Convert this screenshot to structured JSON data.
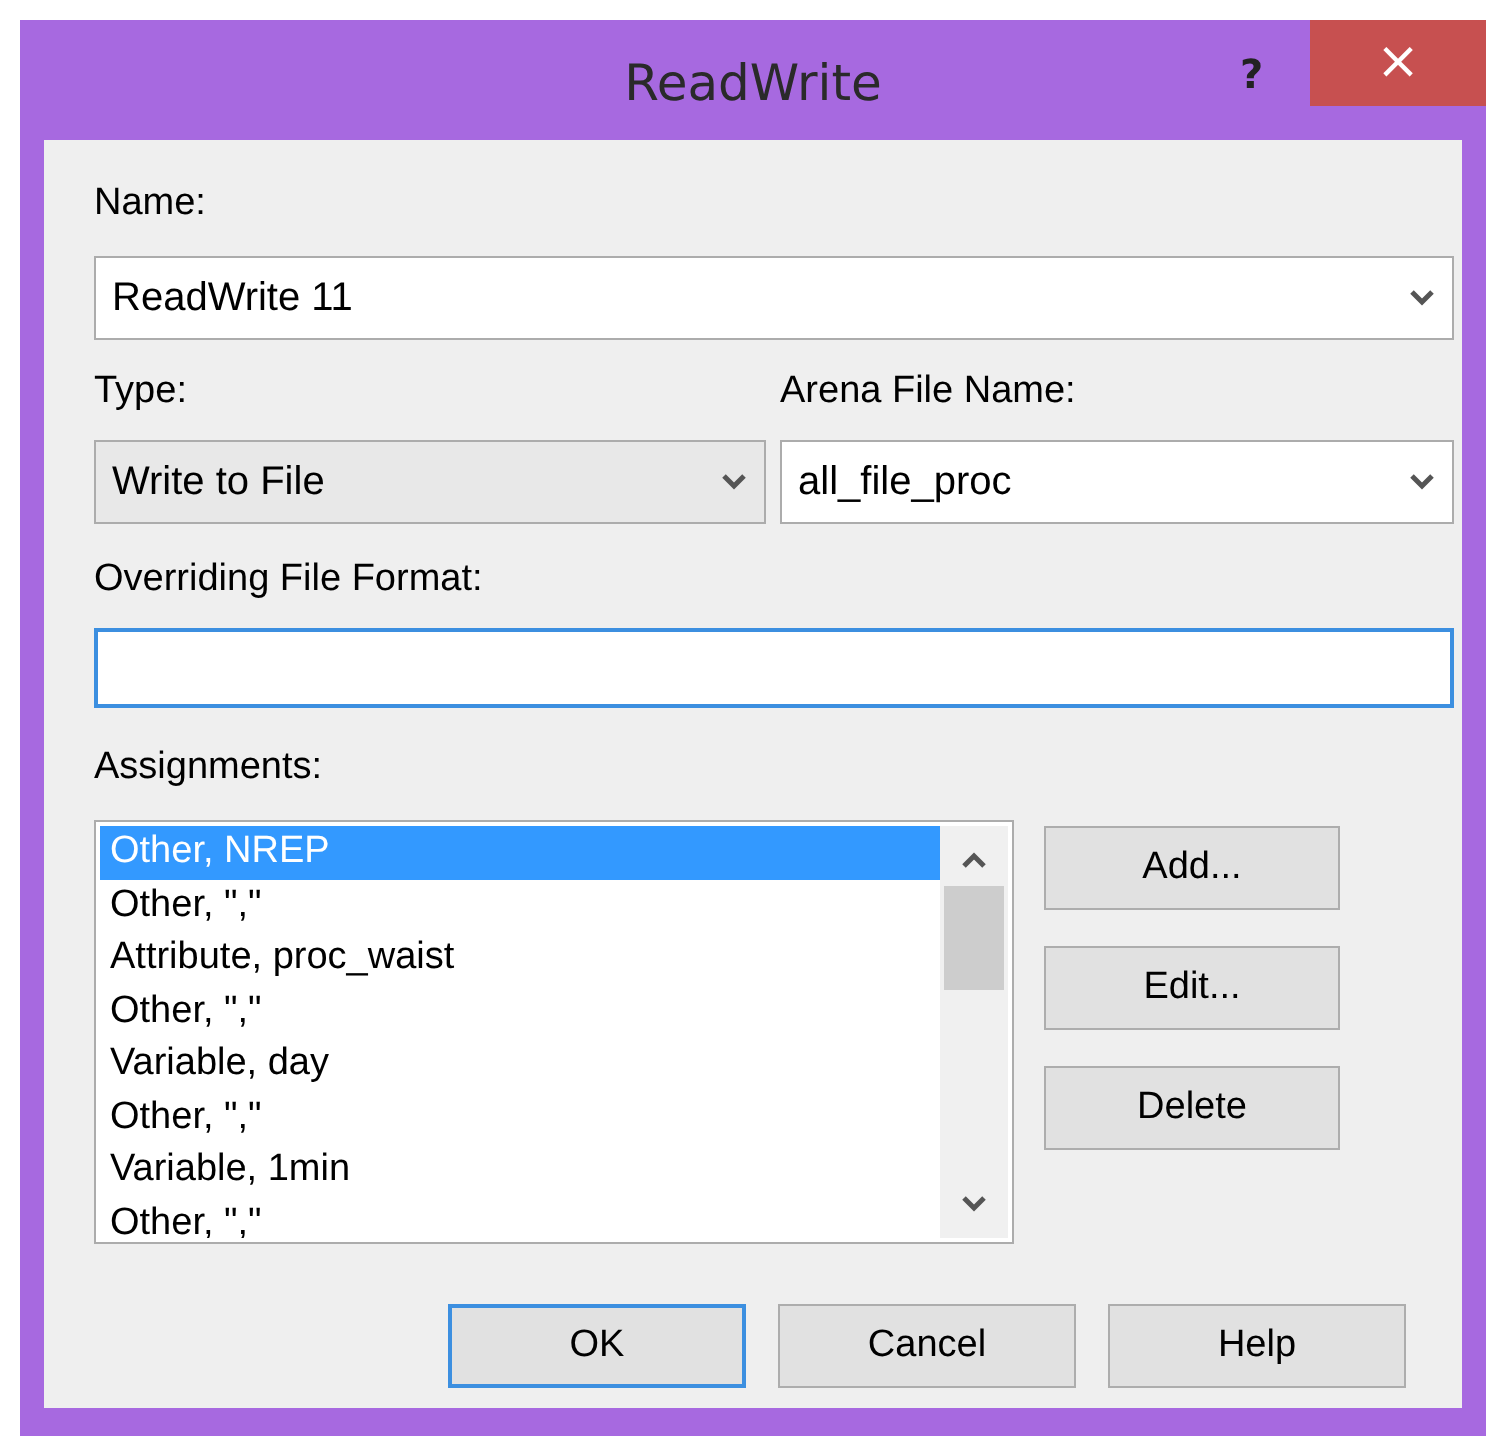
{
  "window": {
    "title": "ReadWrite",
    "help_button": "?",
    "close_button": "×"
  },
  "name": {
    "label": "Name:",
    "value": "ReadWrite 11"
  },
  "type": {
    "label": "Type:",
    "value": "Write to File"
  },
  "arena_file_name": {
    "label": "Arena File Name:",
    "value": "all_file_proc"
  },
  "overriding_file_format": {
    "label": "Overriding File Format:"
  },
  "assignments": {
    "label": "Assignments:",
    "items": [
      {
        "text": "Other, NREP",
        "selected": true
      },
      {
        "text": "Other, \",\"",
        "selected": false
      },
      {
        "text": "Attribute, proc_waist",
        "selected": false
      },
      {
        "text": "Other, \",\"",
        "selected": false
      },
      {
        "text": "Variable, day",
        "selected": false
      },
      {
        "text": "Other, \",\"",
        "selected": false
      },
      {
        "text": "Variable, 1min",
        "selected": false
      },
      {
        "text": "Other, \",\"",
        "selected": false
      }
    ]
  },
  "side_buttons": [
    "Add...",
    "Edit...",
    "Delete"
  ],
  "buttons": [
    {
      "label": "OK",
      "kind": "default"
    },
    {
      "label": "Cancel",
      "kind": "normal"
    },
    {
      "label": "Help",
      "kind": "normal"
    }
  ]
}
